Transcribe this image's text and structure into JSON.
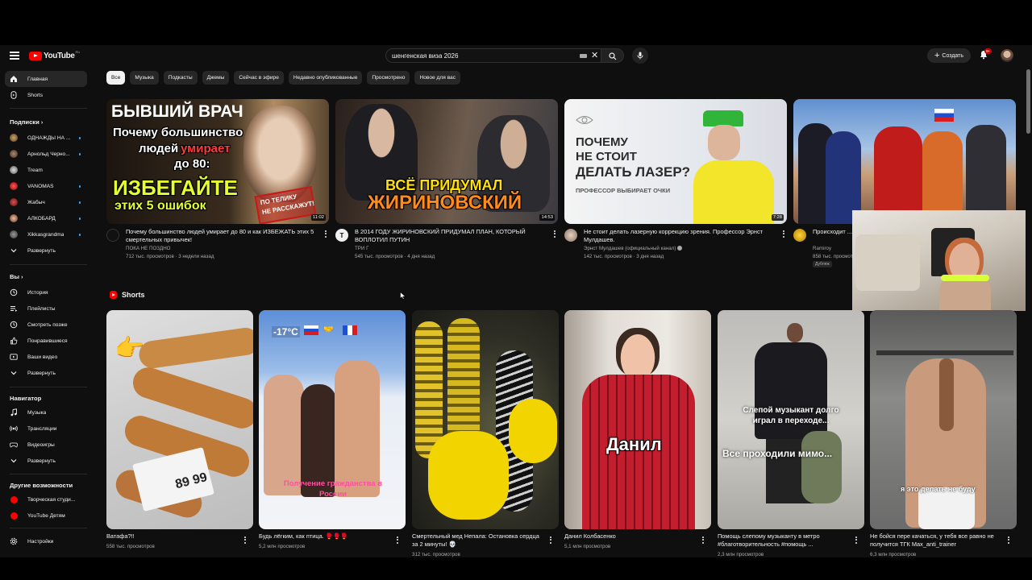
{
  "app": {
    "title": "YouTube",
    "region": "RU"
  },
  "search": {
    "value": "шенгенская виза 2026",
    "placeholder": "Введите запрос"
  },
  "header": {
    "create_label": "Создать",
    "notifications_badge": "9+"
  },
  "sidebar": {
    "home": "Главная",
    "shorts": "Shorts",
    "subscriptions_heading": "Подписки",
    "subscriptions": [
      {
        "label": "ОДНАЖДЫ НА ...",
        "new": true
      },
      {
        "label": "Арнольд Черно...",
        "new": true
      },
      {
        "label": "Tream",
        "new": false
      },
      {
        "label": "VANOMAS",
        "new": true
      },
      {
        "label": "Жабыч",
        "new": true
      },
      {
        "label": "АЛКОБАРД",
        "new": true
      },
      {
        "label": "Xikkasgrandma",
        "new": true
      }
    ],
    "expand": "Развернуть",
    "you_heading": "Вы",
    "you_items": [
      "История",
      "Плейлисты",
      "Смотреть позже",
      "Понравившиеся",
      "Ваши видео"
    ],
    "navigator_heading": "Навигатор",
    "navigator_items": [
      "Музыка",
      "Трансляции",
      "Видеоигры"
    ],
    "more_heading": "Другие возможности",
    "more_items": [
      "Творческая студи...",
      "YouTube Детям"
    ],
    "settings": "Настройки"
  },
  "chips": [
    "Все",
    "Музыка",
    "Подкасты",
    "Джемы",
    "Сейчас в эфире",
    "Недавно опубликованные",
    "Просмотрено",
    "Новое для вас"
  ],
  "videos": [
    {
      "title": "Почему большинство людей умирает до 80 и как ИЗБЕЖАТЬ этих 5 смертельных привычек!",
      "channel": "ПОКА НЕ ПОЗДНО",
      "stats": "712 тыс. просмотров · 3 недели назад",
      "duration": "11:02",
      "thumb_lines": [
        "БЫВШИЙ ВРАЧ",
        "Почему большинство",
        "людей",
        "умирает",
        "до 80:",
        "ИЗБЕГАЙТЕ",
        "этих 5 ошибок",
        "ПО ТЕЛИКУ",
        "НЕ РАССКАЖУТ!"
      ]
    },
    {
      "title": "В 2014 ГОДУ ЖИРИНОВСКИЙ ПРИДУМАЛ ПЛАН, КОТОРЫЙ ВОПЛОТИЛ ПУТИН",
      "channel": "ТРИ Г",
      "stats": "545 тыс. просмотров · 4 дня назад",
      "duration": "14:53",
      "avatar_letter": "T",
      "thumb_lines": [
        "ВСЁ ПРИДУМАЛ",
        "ЖИРИНОВСКИЙ"
      ]
    },
    {
      "title": "Не стоит делать лазерную коррекцию зрения. Профессор Эрнст Мулдашев.",
      "channel": "Эрнст Мулдашев (официальный канал)",
      "stats": "142 тыс. просмотров · 3 дня назад",
      "duration": "7:28",
      "thumb_lines": [
        "ПОЧЕМУ",
        "НЕ СТОИТ",
        "ДЕЛАТЬ ЛАЗЕР?",
        "ПРОФЕССОР ВЫБИРАЕТ ОЧКИ"
      ]
    },
    {
      "title": "Происходит ... русскими",
      "channel": "Ramiroy",
      "stats": "858 тыс. просмотров",
      "badge": "Дубляж"
    }
  ],
  "shorts_heading": "Shorts",
  "shorts": [
    {
      "title": "Ватафа?!!",
      "views": "558 тыс. просмотров",
      "thumb_text": "89 99"
    },
    {
      "title": "Будь лёгким, как птица. 🥊🥊🥊",
      "views": "5,2 млн просмотров",
      "thumb_text": "-17°C",
      "thumb_caption": "Получение гражданства в России"
    },
    {
      "title": "Смертельный мед Непала: Остановка сердца за 2 минуты! 💀",
      "views": "312 тыс. просмотров"
    },
    {
      "title": "Данил Колбасенко",
      "views": "5,1 млн просмотров",
      "thumb_text": "Данил"
    },
    {
      "title": "Помощь слепому музыканту в метро #благотворительность #помощь ...",
      "views": "2,3 млн просмотров",
      "thumb_text": "Слепой музыкант долго играл в переходе...",
      "thumb_caption": "Все проходили мимо..."
    },
    {
      "title": "Не бойся пере качаться, у тебя все равно не получится ТГК Max_anti_trainer",
      "views": "6,3 млн просмотров",
      "thumb_caption": "я это делать не буду"
    }
  ],
  "colors": {
    "background": "#0f0f0f",
    "accent": "#ff0000",
    "chip": "#272727",
    "badge": "#cc0000"
  }
}
